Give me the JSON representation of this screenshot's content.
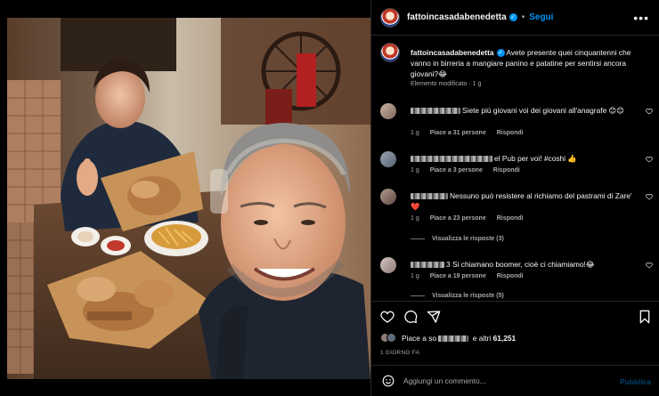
{
  "post": {
    "username": "fattoincasadabenedetta",
    "follow_label": "Segui",
    "dot": "•",
    "more_icon": "more-options-icon"
  },
  "caption": {
    "username": "fattoincasadabenedetta",
    "text": "Avete presente quei cinquantenni che vanno in birreria a mangiare panino e patatine per sentirsi ancora giovani?😂",
    "meta": "Elemento modificato · 1 g"
  },
  "comments": [
    {
      "text": "Siete più giovani voi dei giovani all'anagrafe 😊😊",
      "time": "1 g",
      "likes": "Piace a 31 persone",
      "reply": "Rispondi"
    },
    {
      "text": "el Pub per voi! #coshi 👍",
      "time": "1 g",
      "likes": "Piace a 3 persone",
      "reply": "Rispondi"
    },
    {
      "text": "Nessuno può resistere al richiamo del pastrami di Zare' ❤️",
      "time": "1 g",
      "likes": "Piace a 23 persone",
      "reply": "Rispondi",
      "view_replies": "Visualizza le risposte (3)"
    },
    {
      "text": "3 Si chiamano boomer, cioè ci chiamiamo!😂",
      "time": "1 g",
      "likes": "Piace a 19 persone",
      "reply": "Rispondi",
      "view_replies": "Visualizza le risposte (5)"
    }
  ],
  "actions": {
    "likes_prefix": "Piace a so",
    "likes_suffix": "e altri",
    "likes_count": "61,251",
    "time_ago": "1 GIORNO FA"
  },
  "add_comment": {
    "placeholder": "Aggiungi un commento...",
    "publish": "Pubblica"
  },
  "colors": {
    "background": "#000000",
    "accent": "#0095f6",
    "muted_text": "#a8a8a8",
    "heart": "#ed4956"
  }
}
